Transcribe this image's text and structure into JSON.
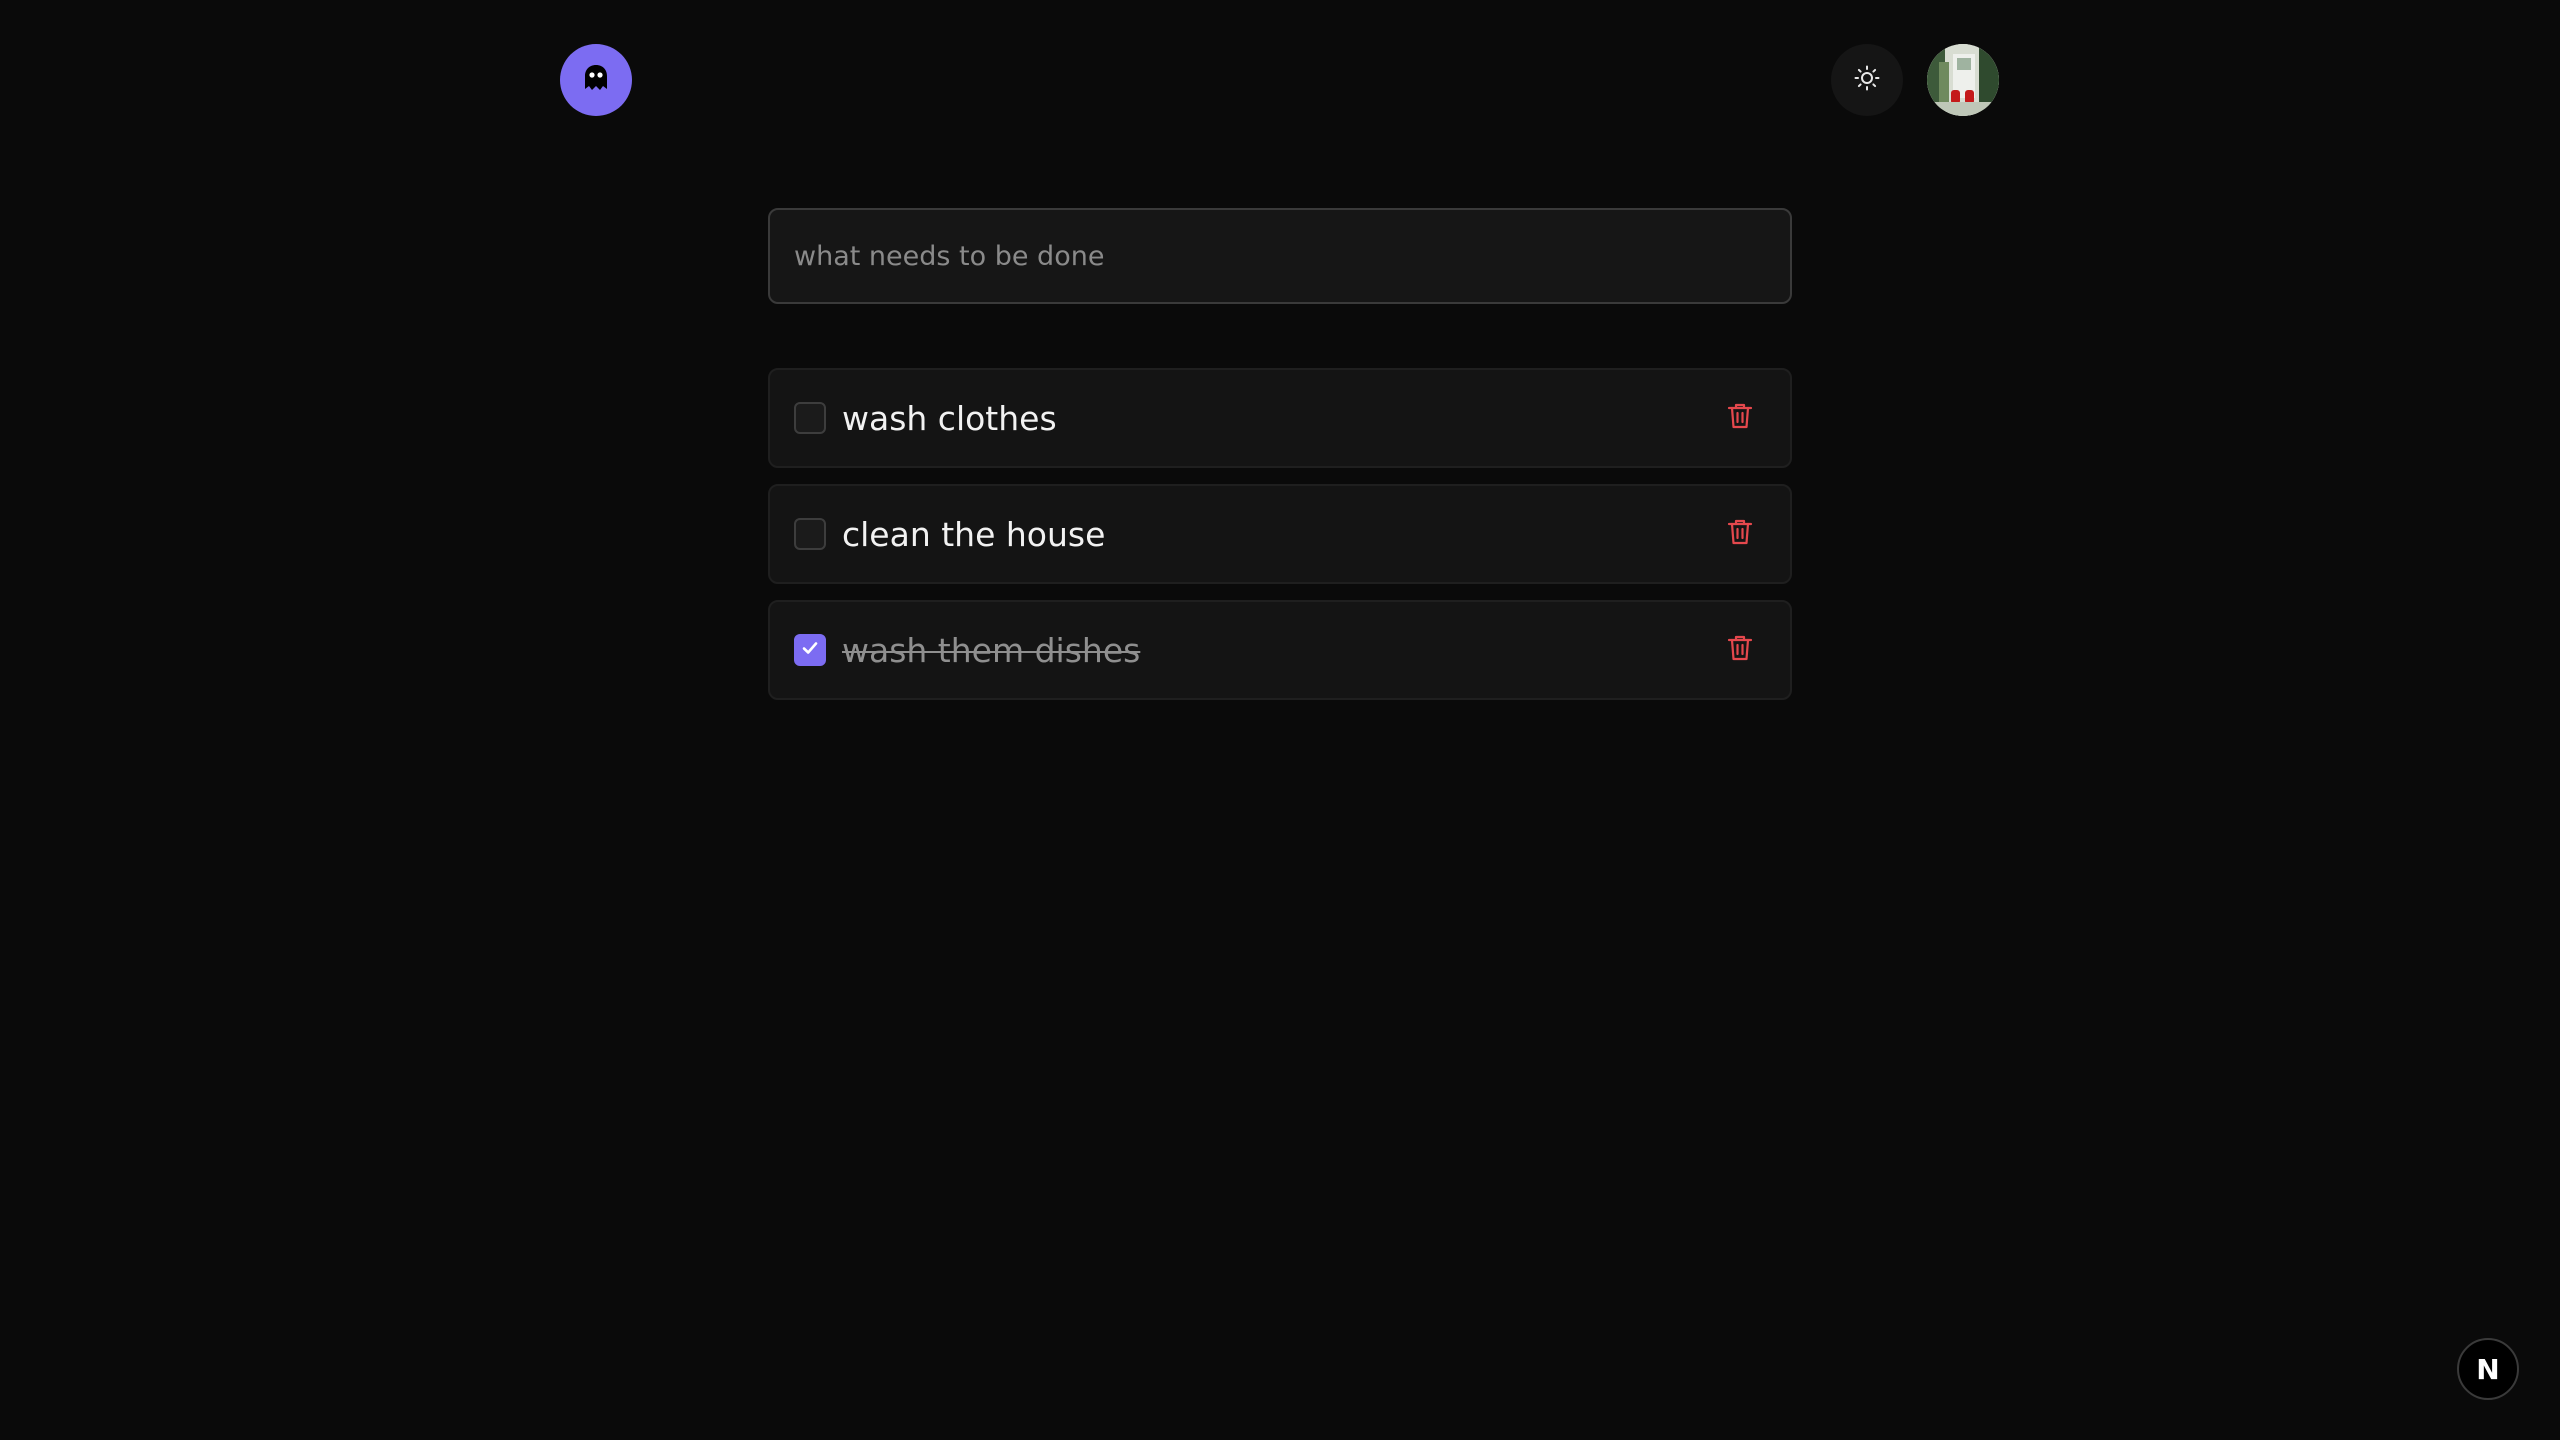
{
  "header": {
    "logo_icon": "ghost-icon",
    "theme_toggle_icon": "sun-icon",
    "avatar_icon": "user-avatar"
  },
  "new_todo": {
    "placeholder": "what needs to be done",
    "value": ""
  },
  "todos": [
    {
      "text": "wash clothes",
      "completed": false
    },
    {
      "text": "clean the house",
      "completed": false
    },
    {
      "text": "wash them dishes",
      "completed": true
    }
  ],
  "colors": {
    "accent": "#7c6cf2",
    "delete": "#e5484d",
    "background": "#0a0a0a"
  },
  "badge": {
    "label": "N"
  }
}
